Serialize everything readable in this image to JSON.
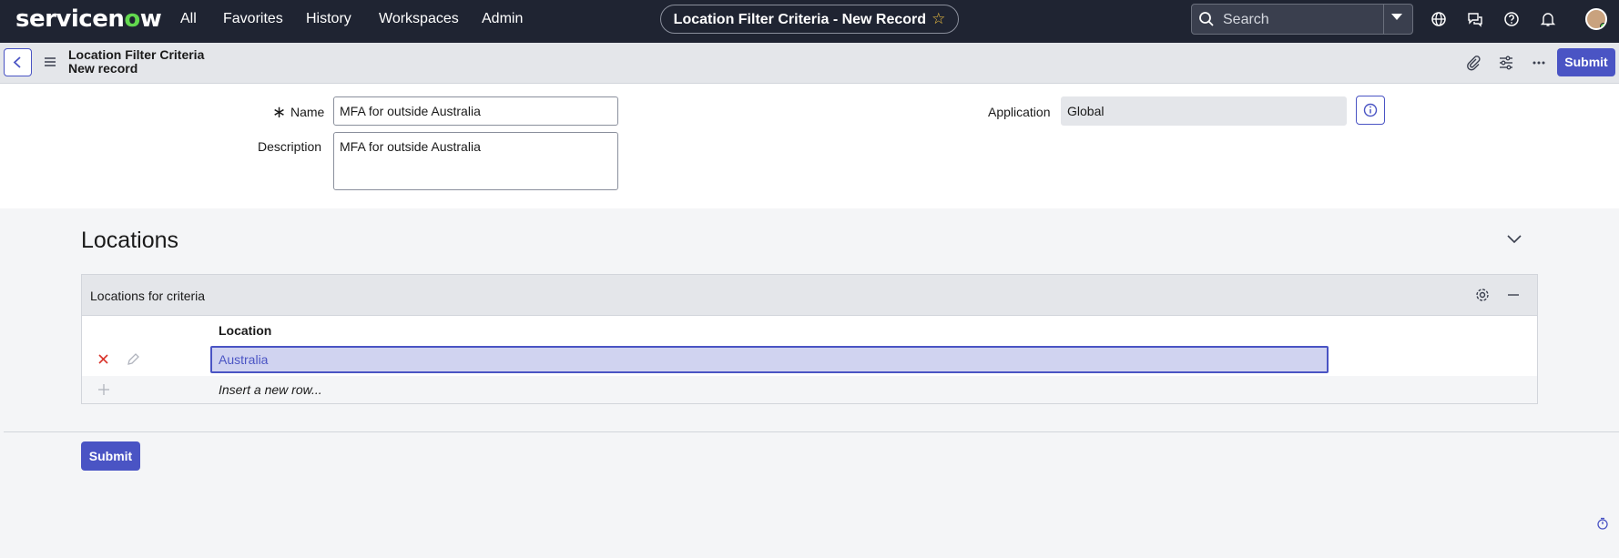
{
  "brand": {
    "logo_pre": "servicen",
    "logo_o": "o",
    "logo_post": "w"
  },
  "nav": {
    "items": [
      "All",
      "Favorites",
      "History",
      "Workspaces",
      "Admin"
    ]
  },
  "page_title": "Location Filter Criteria - New Record",
  "search": {
    "placeholder": "Search"
  },
  "record": {
    "table": "Location Filter Criteria",
    "state": "New record",
    "submit_label": "Submit"
  },
  "form": {
    "name_label": "Name",
    "name_value": "MFA for outside Australia",
    "description_label": "Description",
    "description_value": "MFA for outside Australia",
    "application_label": "Application",
    "application_value": "Global"
  },
  "related": {
    "section_title": "Locations",
    "list_title": "Locations for criteria",
    "column": "Location",
    "rows": [
      "Australia"
    ],
    "insert_label": "Insert a new row..."
  },
  "footer": {
    "submit_label": "Submit"
  },
  "colors": {
    "accent": "#4a54c4",
    "topbar": "#1f2432",
    "brand_green": "#62d84e",
    "delete_red": "#d9342b"
  },
  "icons": [
    "search-icon",
    "dropdown-caret-icon",
    "globe-icon",
    "chat-icon",
    "help-icon",
    "bell-icon",
    "back-arrow-icon",
    "hamburger-icon",
    "paperclip-icon",
    "sliders-icon",
    "more-icon",
    "required-asterisk-icon",
    "info-icon",
    "chevron-down-icon",
    "gear-icon",
    "minimize-icon",
    "delete-x-icon",
    "pencil-icon",
    "plus-icon",
    "timer-icon"
  ]
}
